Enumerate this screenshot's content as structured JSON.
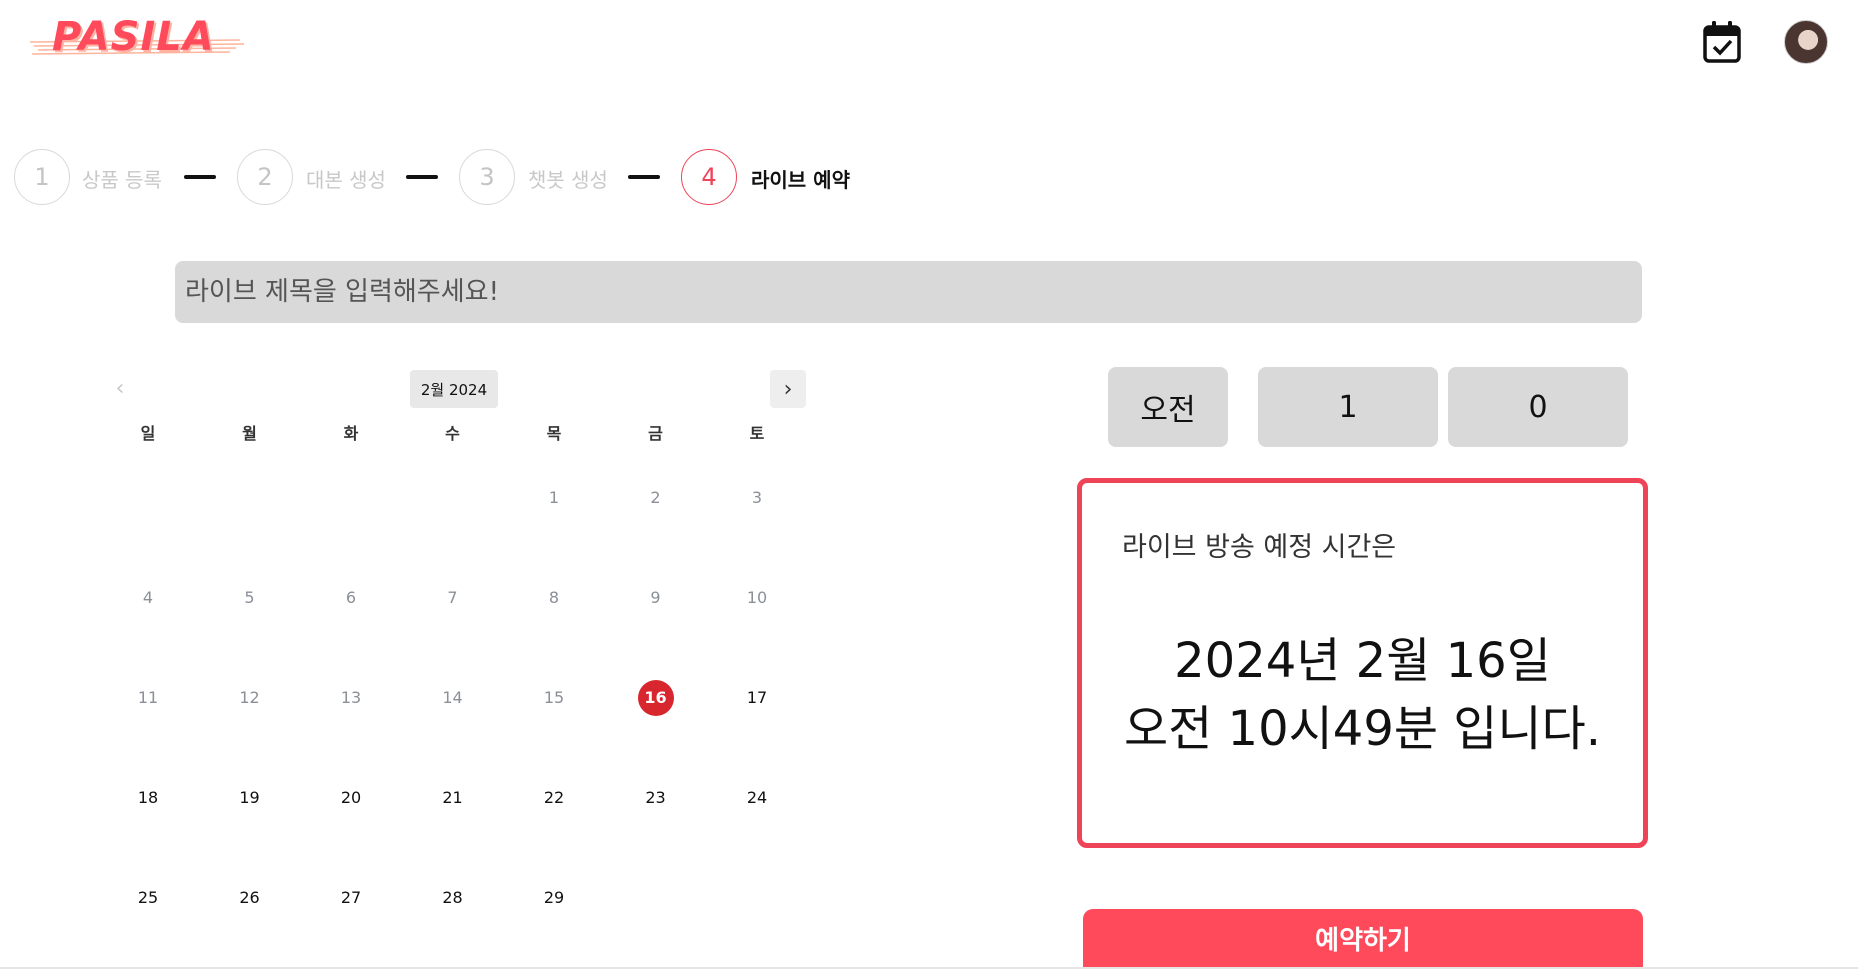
{
  "header": {
    "logo_text": "PASILA",
    "calendar_icon": "calendar-check-icon",
    "avatar_icon": "user-avatar"
  },
  "stepper": {
    "steps": [
      {
        "number": "1",
        "label": "상품 등록",
        "active": false
      },
      {
        "number": "2",
        "label": "대본 생성",
        "active": false
      },
      {
        "number": "3",
        "label": "챗봇 생성",
        "active": false
      },
      {
        "number": "4",
        "label": "라이브 예약",
        "active": true
      }
    ],
    "active_color": "#ef4458"
  },
  "title_input": {
    "value": "",
    "placeholder": "라이브 제목을 입력해주세요!"
  },
  "calendar": {
    "month_label": "2월 2024",
    "prev_icon": "chevron-left-icon",
    "next_icon": "chevron-right-icon",
    "weekdays": [
      "일",
      "월",
      "화",
      "수",
      "목",
      "금",
      "토"
    ],
    "first_weekday_index": 4,
    "days_in_month": 29,
    "selected_day": "16",
    "weeks": [
      [
        "",
        "",
        "",
        "",
        "1",
        "2",
        "3"
      ],
      [
        "4",
        "5",
        "6",
        "7",
        "8",
        "9",
        "10"
      ],
      [
        "11",
        "12",
        "13",
        "14",
        "15",
        "16",
        "17"
      ],
      [
        "18",
        "19",
        "20",
        "21",
        "22",
        "23",
        "24"
      ],
      [
        "25",
        "26",
        "27",
        "28",
        "29",
        "",
        ""
      ]
    ],
    "selected_color": "#d8262e"
  },
  "time": {
    "ampm": "오전",
    "hour": "1",
    "minute": "0"
  },
  "result": {
    "label": "라이브 방송 예정 시간은",
    "date_line": "2024년 2월 16일",
    "time_line": "오전 10시49분 입니다.",
    "border_color": "#ef4458"
  },
  "reserve_button": {
    "label": "예약하기",
    "color": "#ff4a5c"
  }
}
